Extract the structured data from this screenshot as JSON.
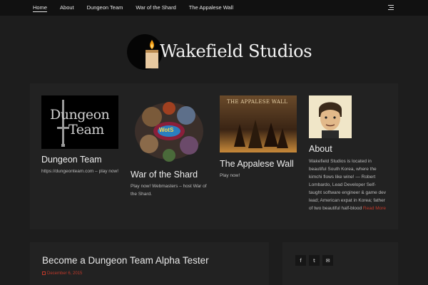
{
  "nav": {
    "items": [
      {
        "label": "Home",
        "active": true
      },
      {
        "label": "About"
      },
      {
        "label": "Dungeon Team"
      },
      {
        "label": "War of the Shard"
      },
      {
        "label": "The Appalese Wall"
      }
    ],
    "menu_icon": "list-icon"
  },
  "logo": {
    "text": "Wakefield Studios",
    "icon": "candle-icon"
  },
  "featured": {
    "cards": [
      {
        "title": "Dungeon Team",
        "excerpt": "https://dungeonteam.com – play now!",
        "image_text_line1": "Dungeon",
        "image_text_line2": "Team"
      },
      {
        "title": "War of the Shard",
        "excerpt": "Play now! Webmasters – host War of the Shard.",
        "image_badge": "WotS"
      },
      {
        "title": "The Appalese Wall",
        "excerpt": "Play now!",
        "image_caption": "THE APPALESE WALL"
      },
      {
        "title": "About",
        "excerpt": "Wakefield Studios is located in beautiful South Korea, where the kimchi flows like wine! — Robert Lombardo, Lead Developer Self-taught software engineer & game dev lead; American expat in Korea; father of two beautiful half-blood",
        "more_label": "Read More"
      }
    ]
  },
  "post": {
    "title": "Become a Dungeon Team Alpha Tester",
    "date": "December 6, 2015"
  },
  "social": {
    "buttons": [
      {
        "icon": "facebook-icon",
        "glyph": "f"
      },
      {
        "icon": "twitter-icon",
        "glyph": "t"
      },
      {
        "icon": "email-icon",
        "glyph": "✉"
      }
    ]
  },
  "colors": {
    "background": "#1d1d1d",
    "panel": "#222222",
    "nav": "#111111",
    "accent": "#c0392b"
  }
}
